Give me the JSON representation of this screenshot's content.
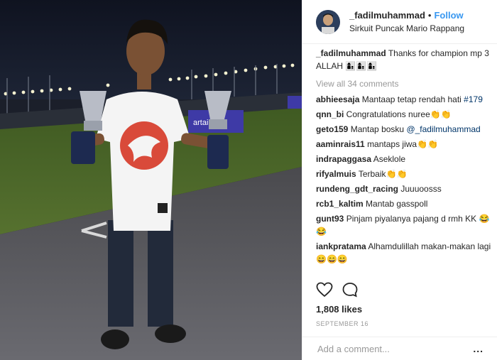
{
  "header": {
    "username": "_fadilmuhammad",
    "separator": "•",
    "follow_label": "Follow",
    "location": "Sirkuit Puncak Mario Rappang"
  },
  "photo": {
    "banner_text": "artai M    m"
  },
  "caption": {
    "user": "_fadilmuhammad",
    "text": "Thanks for champion mp 3 ALLAH 👩‍👦👩‍👦👩‍👦"
  },
  "view_all_label": "View all 34 comments",
  "comments": [
    {
      "user": "abhieesaja",
      "text": "Mantaap tetap rendah hati",
      "tag": "#179"
    },
    {
      "user": "qnn_bi",
      "text": "Congratulations nuree👏👏"
    },
    {
      "user": "geto159",
      "text": "Mantap bosku",
      "mention": "@_fadilmuhammad"
    },
    {
      "user": "aaminrais11",
      "text": "mantaps jiwa👏👏"
    },
    {
      "user": "indrapaggasa",
      "text": "Aseklole"
    },
    {
      "user": "rifyalmuis",
      "text": "Terbaik👏👏"
    },
    {
      "user": "rundeng_gdt_racing",
      "text": "Juuuoosss"
    },
    {
      "user": "rcb1_kaltim",
      "text": "Mantab gasspoll"
    },
    {
      "user": "gunt93",
      "text": "Pinjam piyalanya pajang d rmh KK 😂😂"
    },
    {
      "user": "iankpratama",
      "text": "Alhamdulillah makan-makan lagi 😄😄😄"
    }
  ],
  "likes_label": "1,808 likes",
  "date_label": "SEPTEMBER 16",
  "add_comment": {
    "placeholder": "Add a comment...",
    "more_label": "..."
  },
  "icons": {
    "like": "heart-icon",
    "comment": "speech-bubble-icon"
  },
  "colors": {
    "follow": "#3897f0",
    "link": "#003569",
    "muted": "#999999"
  }
}
